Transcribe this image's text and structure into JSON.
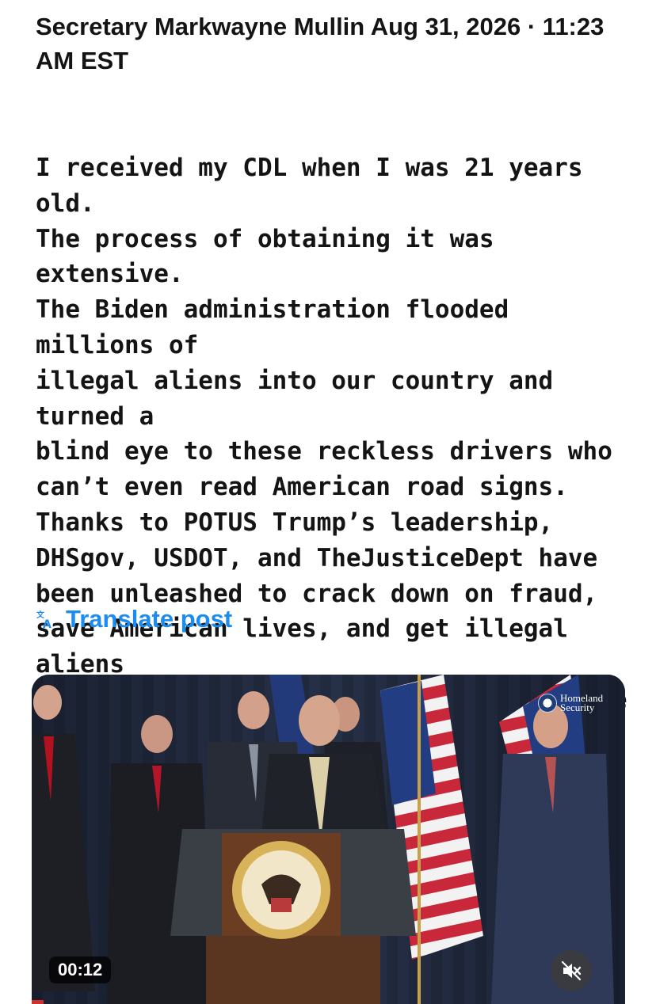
{
  "post": {
    "header": "Secretary Markwayne Mullin Aug 31, 2026 · 11:23 AM EST",
    "body": "I received my CDL when I was 21 years old.\nThe process of obtaining it was extensive.\nThe Biden administration flooded millions of\nillegal aliens into our country and turned a\nblind eye to these reckless drivers who\ncan’t even read American road signs.\nThanks to POTUS Trump’s leadership,\nDHSgov, USDOT, and TheJusticeDept have\nbeen unleashed to crack down on fraud,\nsave American lives, and get illegal aliens\nOFF our streets. We won’t stop until the job\nis done."
  },
  "translate": {
    "label": "Translate post",
    "icon": "translate-icon",
    "color": "#1d8cf0"
  },
  "video": {
    "watermark": "Homeland Security",
    "timestamp": "00:12",
    "mute_icon": "speaker-muted-icon",
    "progress": 0.02
  }
}
